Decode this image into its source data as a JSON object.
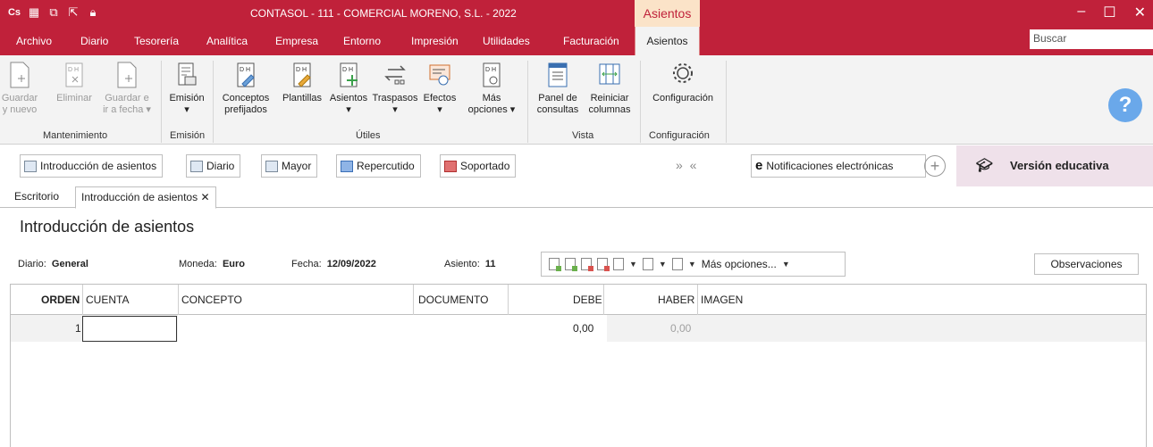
{
  "window": {
    "title": "CONTASOL - 111 - COMERCIAL MORENO, S.L. - 2022",
    "context_tab": "Asientos",
    "app_icon": "Cs"
  },
  "menu": {
    "items": [
      "Archivo",
      "Diario",
      "Tesorería",
      "Analítica",
      "Empresa",
      "Entorno",
      "Impresión",
      "Utilidades",
      "Facturación"
    ],
    "active": "Asientos",
    "search_placeholder": "Buscar"
  },
  "ribbon": {
    "mantenimiento": {
      "label": "Mantenimiento",
      "guardar_nuevo": [
        "Guardar",
        "y nuevo"
      ],
      "eliminar": [
        "Eliminar",
        ""
      ],
      "guardar_ir": [
        "Guardar e",
        "ir a fecha"
      ]
    },
    "emision": {
      "label": "Emisión",
      "btn": "Emisión"
    },
    "utiles": {
      "label": "Útiles",
      "conceptos": [
        "Conceptos",
        "prefijados"
      ],
      "plantillas": "Plantillas",
      "asientos": "Asientos",
      "traspasos": "Traspasos",
      "efectos": "Efectos",
      "mas": [
        "Más",
        "opciones"
      ]
    },
    "vista": {
      "label": "Vista",
      "panel": [
        "Panel de",
        "consultas"
      ],
      "reiniciar": [
        "Reiniciar",
        "columnas"
      ]
    },
    "configuracion": {
      "label": "Configuración",
      "btn": "Configuración"
    }
  },
  "shortcuts": {
    "intro": "Introducción de asientos",
    "diario": "Diario",
    "mayor": "Mayor",
    "repercutido": "Repercutido",
    "soportado": "Soportado",
    "arrows": "» «",
    "notificaciones": "Notificaciones electrónicas",
    "version": "Versión educativa"
  },
  "tabs": {
    "escritorio": "Escritorio",
    "intro": "Introducción de asientos"
  },
  "page": {
    "title": "Introducción de asientos"
  },
  "info": {
    "diario_label": "Diario:",
    "diario_value": "General",
    "moneda_label": "Moneda:",
    "moneda_value": "Euro",
    "fecha_label": "Fecha:",
    "fecha_value": "12/09/2022",
    "asiento_label": "Asiento:",
    "asiento_value": "11",
    "mas_opciones": "Más opciones...",
    "observaciones": "Observaciones"
  },
  "table": {
    "headers": [
      "ORDEN",
      "CUENTA",
      "CONCEPTO",
      "DOCUMENTO",
      "DEBE",
      "HABER",
      "IMAGEN"
    ],
    "rows": [
      {
        "orden": "1",
        "cuenta": "",
        "concepto": "",
        "documento": "",
        "debe": "0,00",
        "haber": "0,00"
      }
    ]
  },
  "colors": {
    "brand": "#c0213a",
    "ribbon_bg": "#f3f3f3",
    "edu_bg": "#efe1ea"
  }
}
